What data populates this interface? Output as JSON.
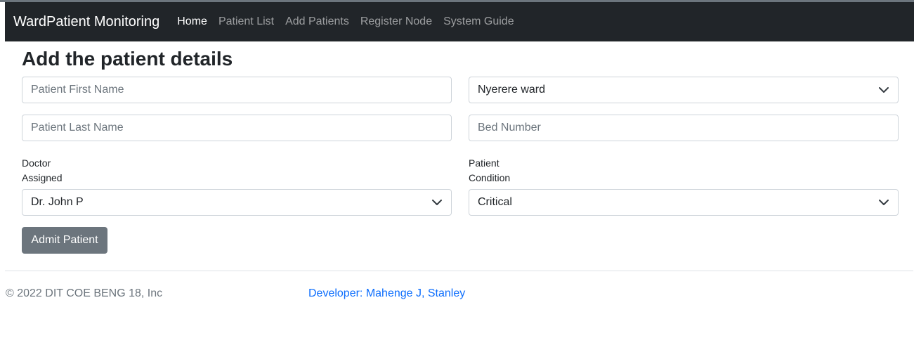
{
  "navbar": {
    "brand": "WardPatient Monitoring",
    "links": [
      {
        "label": "Home",
        "active": true
      },
      {
        "label": "Patient List",
        "active": false
      },
      {
        "label": "Add Patients",
        "active": false
      },
      {
        "label": "Register Node",
        "active": false
      },
      {
        "label": "System Guide",
        "active": false
      }
    ]
  },
  "form": {
    "title": "Add the patient details",
    "first_name": {
      "placeholder": "Patient First Name",
      "value": ""
    },
    "last_name": {
      "placeholder": "Patient Last Name",
      "value": ""
    },
    "ward": {
      "selected": "Nyerere ward"
    },
    "bed_number": {
      "placeholder": "Bed Number",
      "value": ""
    },
    "doctor": {
      "label_line1": "Doctor",
      "label_line2": "Assigned",
      "selected": "Dr. John P"
    },
    "condition": {
      "label_line1": "Patient",
      "label_line2": "Condition",
      "selected": "Critical"
    },
    "submit_label": "Admit Patient"
  },
  "footer": {
    "copyright": "© 2022 DIT COE BENG 18, Inc",
    "developer": "Developer: Mahenge J, Stanley"
  },
  "colors": {
    "navbar_bg": "#212529",
    "button_bg": "#6c757d",
    "link": "#0d6efd"
  }
}
